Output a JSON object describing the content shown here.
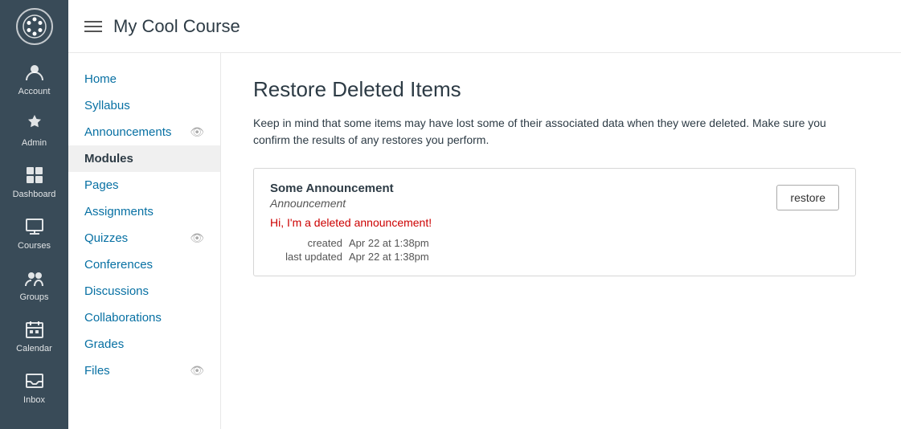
{
  "globalNav": {
    "items": [
      {
        "id": "account",
        "label": "Account",
        "icon": "account"
      },
      {
        "id": "admin",
        "label": "Admin",
        "icon": "admin"
      },
      {
        "id": "dashboard",
        "label": "Dashboard",
        "icon": "dashboard"
      },
      {
        "id": "courses",
        "label": "Courses",
        "icon": "courses"
      },
      {
        "id": "groups",
        "label": "Groups",
        "icon": "groups"
      },
      {
        "id": "calendar",
        "label": "Calendar",
        "icon": "calendar"
      },
      {
        "id": "inbox",
        "label": "Inbox",
        "icon": "inbox"
      }
    ]
  },
  "header": {
    "courseTitle": "My Cool Course",
    "hamburgerLabel": "Toggle navigation"
  },
  "courseNav": {
    "items": [
      {
        "id": "home",
        "label": "Home",
        "active": false,
        "hasEye": false
      },
      {
        "id": "syllabus",
        "label": "Syllabus",
        "active": false,
        "hasEye": false
      },
      {
        "id": "announcements",
        "label": "Announcements",
        "active": false,
        "hasEye": true
      },
      {
        "id": "modules",
        "label": "Modules",
        "active": true,
        "hasEye": false
      },
      {
        "id": "pages",
        "label": "Pages",
        "active": false,
        "hasEye": false
      },
      {
        "id": "assignments",
        "label": "Assignments",
        "active": false,
        "hasEye": false
      },
      {
        "id": "quizzes",
        "label": "Quizzes",
        "active": false,
        "hasEye": true
      },
      {
        "id": "conferences",
        "label": "Conferences",
        "active": false,
        "hasEye": false
      },
      {
        "id": "discussions",
        "label": "Discussions",
        "active": false,
        "hasEye": false
      },
      {
        "id": "collaborations",
        "label": "Collaborations",
        "active": false,
        "hasEye": false
      },
      {
        "id": "grades",
        "label": "Grades",
        "active": false,
        "hasEye": false
      },
      {
        "id": "files",
        "label": "Files",
        "active": false,
        "hasEye": true
      }
    ]
  },
  "page": {
    "title": "Restore Deleted Items",
    "description": "Keep in mind that some items may have lost some of their associated data when they were deleted. Make sure you confirm the results of any restores you perform.",
    "restoreButton": "restore",
    "item": {
      "title": "Some Announcement",
      "type": "Announcement",
      "preview": "Hi, I'm a deleted announcement!",
      "created": "Apr 22 at 1:38pm",
      "lastUpdated": "Apr 22 at 1:38pm",
      "createdLabel": "created",
      "lastUpdatedLabel": "last updated"
    }
  }
}
